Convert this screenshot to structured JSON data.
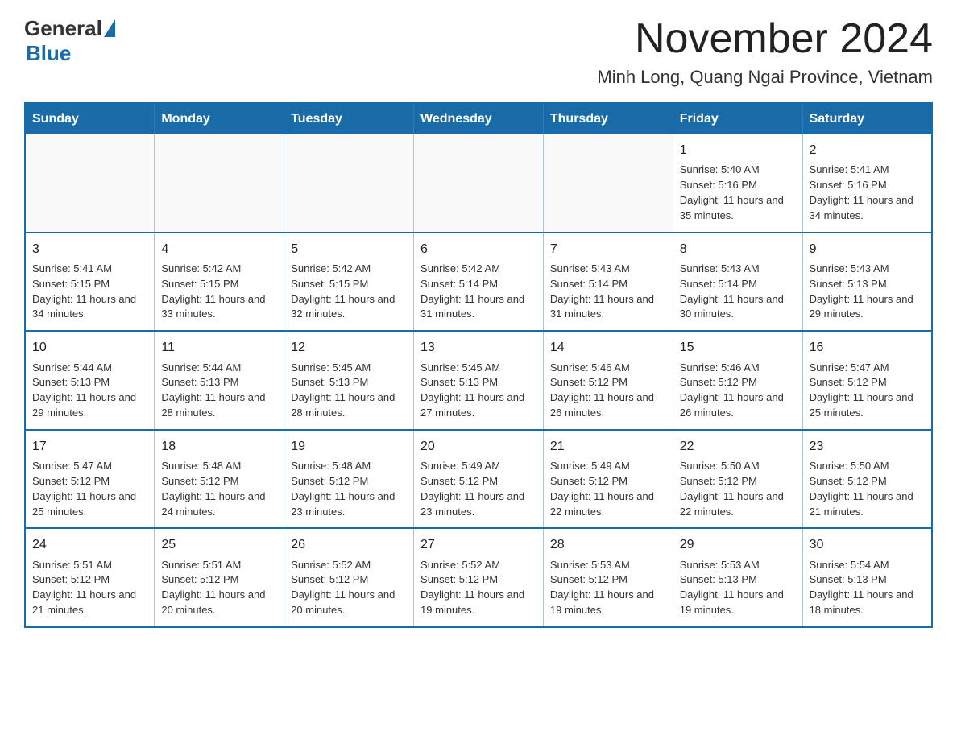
{
  "header": {
    "logo_general": "General",
    "logo_blue": "Blue",
    "month_title": "November 2024",
    "location": "Minh Long, Quang Ngai Province, Vietnam"
  },
  "days_of_week": [
    "Sunday",
    "Monday",
    "Tuesday",
    "Wednesday",
    "Thursday",
    "Friday",
    "Saturday"
  ],
  "weeks": [
    [
      {
        "day": "",
        "info": ""
      },
      {
        "day": "",
        "info": ""
      },
      {
        "day": "",
        "info": ""
      },
      {
        "day": "",
        "info": ""
      },
      {
        "day": "",
        "info": ""
      },
      {
        "day": "1",
        "info": "Sunrise: 5:40 AM\nSunset: 5:16 PM\nDaylight: 11 hours and 35 minutes."
      },
      {
        "day": "2",
        "info": "Sunrise: 5:41 AM\nSunset: 5:16 PM\nDaylight: 11 hours and 34 minutes."
      }
    ],
    [
      {
        "day": "3",
        "info": "Sunrise: 5:41 AM\nSunset: 5:15 PM\nDaylight: 11 hours and 34 minutes."
      },
      {
        "day": "4",
        "info": "Sunrise: 5:42 AM\nSunset: 5:15 PM\nDaylight: 11 hours and 33 minutes."
      },
      {
        "day": "5",
        "info": "Sunrise: 5:42 AM\nSunset: 5:15 PM\nDaylight: 11 hours and 32 minutes."
      },
      {
        "day": "6",
        "info": "Sunrise: 5:42 AM\nSunset: 5:14 PM\nDaylight: 11 hours and 31 minutes."
      },
      {
        "day": "7",
        "info": "Sunrise: 5:43 AM\nSunset: 5:14 PM\nDaylight: 11 hours and 31 minutes."
      },
      {
        "day": "8",
        "info": "Sunrise: 5:43 AM\nSunset: 5:14 PM\nDaylight: 11 hours and 30 minutes."
      },
      {
        "day": "9",
        "info": "Sunrise: 5:43 AM\nSunset: 5:13 PM\nDaylight: 11 hours and 29 minutes."
      }
    ],
    [
      {
        "day": "10",
        "info": "Sunrise: 5:44 AM\nSunset: 5:13 PM\nDaylight: 11 hours and 29 minutes."
      },
      {
        "day": "11",
        "info": "Sunrise: 5:44 AM\nSunset: 5:13 PM\nDaylight: 11 hours and 28 minutes."
      },
      {
        "day": "12",
        "info": "Sunrise: 5:45 AM\nSunset: 5:13 PM\nDaylight: 11 hours and 28 minutes."
      },
      {
        "day": "13",
        "info": "Sunrise: 5:45 AM\nSunset: 5:13 PM\nDaylight: 11 hours and 27 minutes."
      },
      {
        "day": "14",
        "info": "Sunrise: 5:46 AM\nSunset: 5:12 PM\nDaylight: 11 hours and 26 minutes."
      },
      {
        "day": "15",
        "info": "Sunrise: 5:46 AM\nSunset: 5:12 PM\nDaylight: 11 hours and 26 minutes."
      },
      {
        "day": "16",
        "info": "Sunrise: 5:47 AM\nSunset: 5:12 PM\nDaylight: 11 hours and 25 minutes."
      }
    ],
    [
      {
        "day": "17",
        "info": "Sunrise: 5:47 AM\nSunset: 5:12 PM\nDaylight: 11 hours and 25 minutes."
      },
      {
        "day": "18",
        "info": "Sunrise: 5:48 AM\nSunset: 5:12 PM\nDaylight: 11 hours and 24 minutes."
      },
      {
        "day": "19",
        "info": "Sunrise: 5:48 AM\nSunset: 5:12 PM\nDaylight: 11 hours and 23 minutes."
      },
      {
        "day": "20",
        "info": "Sunrise: 5:49 AM\nSunset: 5:12 PM\nDaylight: 11 hours and 23 minutes."
      },
      {
        "day": "21",
        "info": "Sunrise: 5:49 AM\nSunset: 5:12 PM\nDaylight: 11 hours and 22 minutes."
      },
      {
        "day": "22",
        "info": "Sunrise: 5:50 AM\nSunset: 5:12 PM\nDaylight: 11 hours and 22 minutes."
      },
      {
        "day": "23",
        "info": "Sunrise: 5:50 AM\nSunset: 5:12 PM\nDaylight: 11 hours and 21 minutes."
      }
    ],
    [
      {
        "day": "24",
        "info": "Sunrise: 5:51 AM\nSunset: 5:12 PM\nDaylight: 11 hours and 21 minutes."
      },
      {
        "day": "25",
        "info": "Sunrise: 5:51 AM\nSunset: 5:12 PM\nDaylight: 11 hours and 20 minutes."
      },
      {
        "day": "26",
        "info": "Sunrise: 5:52 AM\nSunset: 5:12 PM\nDaylight: 11 hours and 20 minutes."
      },
      {
        "day": "27",
        "info": "Sunrise: 5:52 AM\nSunset: 5:12 PM\nDaylight: 11 hours and 19 minutes."
      },
      {
        "day": "28",
        "info": "Sunrise: 5:53 AM\nSunset: 5:12 PM\nDaylight: 11 hours and 19 minutes."
      },
      {
        "day": "29",
        "info": "Sunrise: 5:53 AM\nSunset: 5:13 PM\nDaylight: 11 hours and 19 minutes."
      },
      {
        "day": "30",
        "info": "Sunrise: 5:54 AM\nSunset: 5:13 PM\nDaylight: 11 hours and 18 minutes."
      }
    ]
  ]
}
